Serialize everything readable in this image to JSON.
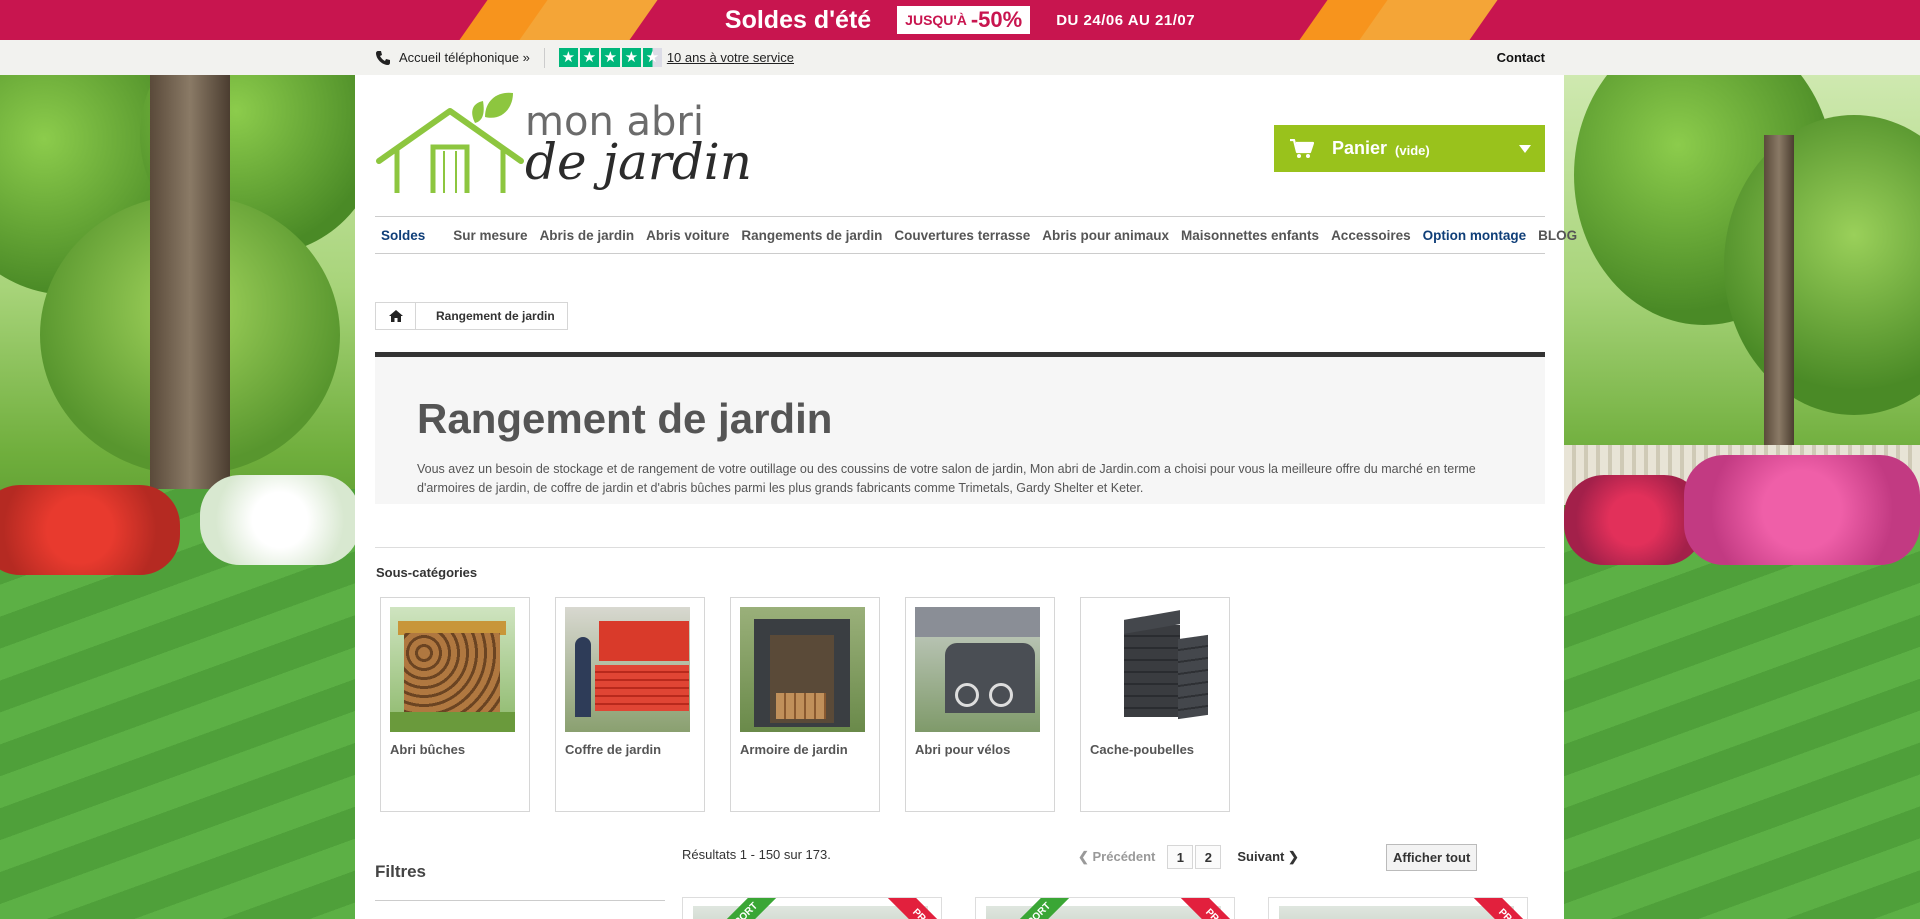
{
  "promo": {
    "title": "Soldes d'été",
    "badge_prefix": "JUSQU'À",
    "badge_value": "-50%",
    "dates": "DU 24/06 AU 21/07",
    "colors": {
      "background": "#c8154f",
      "accent": "#f7941d"
    }
  },
  "utility": {
    "phone_label": "Accueil téléphonique »",
    "service_link": "10 ans à votre service",
    "rating_stars": 4.5,
    "contact": "Contact"
  },
  "logo": {
    "line1": "mon abri",
    "line2": "de jardin",
    "color": "#8dc63f"
  },
  "cart": {
    "label": "Panier",
    "state": "(vide)",
    "color": "#99c21c"
  },
  "nav": {
    "items": [
      {
        "label": "Soldes",
        "highlight": true
      },
      {
        "label": "Sur mesure",
        "highlight": false
      },
      {
        "label": "Abris de jardin",
        "highlight": false
      },
      {
        "label": "Abris voiture",
        "highlight": false
      },
      {
        "label": "Rangements de jardin",
        "highlight": false
      },
      {
        "label": "Couvertures terrasse",
        "highlight": false
      },
      {
        "label": "Abris pour animaux",
        "highlight": false
      },
      {
        "label": "Maisonnettes enfants",
        "highlight": false
      },
      {
        "label": "Accessoires",
        "highlight": false
      },
      {
        "label": "Option montage",
        "highlight": true
      },
      {
        "label": "BLOG",
        "highlight": false
      }
    ]
  },
  "breadcrumb": {
    "current": "Rangement de jardin"
  },
  "category": {
    "title": "Rangement de jardin",
    "description": "Vous avez un besoin de stockage et de rangement de votre outillage ou des coussins de votre salon de jardin, Mon abri de Jardin.com a choisi pour vous la meilleure offre du marché en terme d'armoires de jardin, de coffre de jardin et d'abris bûches parmi les plus grands fabricants comme Trimetals, Gardy Shelter et Keter."
  },
  "subcategories": {
    "heading": "Sous-catégories",
    "items": [
      {
        "name": "Abri bûches",
        "icon": "log-shelter-image"
      },
      {
        "name": "Coffre de jardin",
        "icon": "garden-chest-image"
      },
      {
        "name": "Armoire de jardin",
        "icon": "garden-cabinet-image"
      },
      {
        "name": "Abri pour vélos",
        "icon": "bike-shelter-image"
      },
      {
        "name": "Cache-poubelles",
        "icon": "bin-store-image"
      }
    ]
  },
  "listing": {
    "filters_title": "Filtres",
    "results_text": "Résultats 1 - 150 sur 173.",
    "prev_label": "Précédent",
    "pages": [
      "1",
      "2"
    ],
    "next_label": "Suivant",
    "show_all": "Afficher tout"
  },
  "products": [
    {
      "ribbon_left": "PORT",
      "ribbon_right": "PRO"
    },
    {
      "ribbon_left": "PORT",
      "ribbon_right": "PRO"
    },
    {
      "ribbon_left": "",
      "ribbon_right": "PRO"
    }
  ]
}
